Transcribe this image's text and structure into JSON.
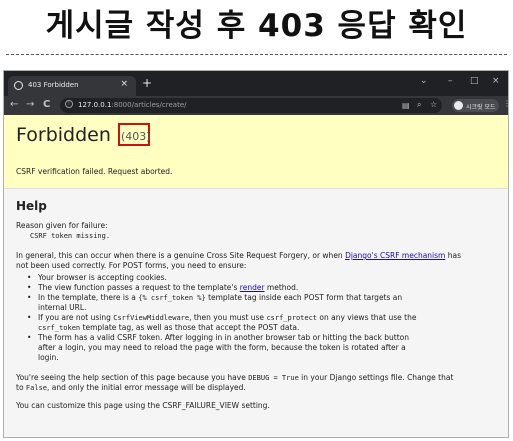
{
  "caption": {
    "headline": "게시글 작성 후 403 응답 확인"
  },
  "browser": {
    "tab_title": "403 Forbidden",
    "tab_close": "×",
    "new_tab": "+",
    "window_controls": {
      "dropdown": "⌄",
      "minimize": "–",
      "maximize": "□",
      "close": "×"
    },
    "nav": {
      "back": "←",
      "forward": "→",
      "reload": "C"
    },
    "address_host": "127.0.0.1",
    "address_rest": ":8000/articles/create/",
    "profile_name": "시크릿 모드",
    "icons": [
      "translate-icon",
      "zoom-icon",
      "bookmark-star-icon",
      "extensions-icon",
      "sidepanel-icon",
      "incognito-icon",
      "menu-icon"
    ]
  },
  "error": {
    "title": "Forbidden",
    "code": "(403)",
    "message": "CSRF verification failed. Request aborted.",
    "highlight_color": "#ffffc2",
    "code_box_color": "#cc1111"
  },
  "help": {
    "heading": "Help",
    "reason_label": "Reason given for failure:",
    "reason_value": "CSRF token missing.",
    "general_1": "In general, this can occur when there is a genuine Cross Site Request Forgery, or when ",
    "general_link": "Django's CSRF mechanism",
    "general_2": " has",
    "general_3": "not been used correctly. For POST forms, you need to ensure:",
    "items": {
      "i1": "Your browser is accepting cookies.",
      "i2a": "The view function passes a request to the template's ",
      "i2link": "render",
      "i2b": " method.",
      "i3a": "In the template, there is a ",
      "i3code": "{% csrf_token %}",
      "i3b": " template tag inside each POST form that targets an",
      "i3c": "internal URL.",
      "i4a": "If you are not using ",
      "i4code": "CsrfViewMiddleware",
      "i4b": ", then you must use ",
      "i4code2": "csrf_protect",
      "i4c": " on any views that use the",
      "i4d": "csrf_token",
      "i4e": " template tag, as well as those that accept the POST data.",
      "i5a": "The form has a valid CSRF token. After logging in in another browser tab or hitting the back button",
      "i5b": "after a login, you may need to reload the page with the form, because the token is rotated after a",
      "i5c": "login."
    },
    "debug_1": "You're seeing the help section of this page because you have ",
    "debug_code": "DEBUG = True",
    "debug_2": " in your Django settings file. Change that",
    "debug_3": "to ",
    "debug_code2": "False",
    "debug_4": ", and only the initial error message will be displayed.",
    "customize": "You can customize this page using the CSRF_FAILURE_VIEW setting."
  }
}
